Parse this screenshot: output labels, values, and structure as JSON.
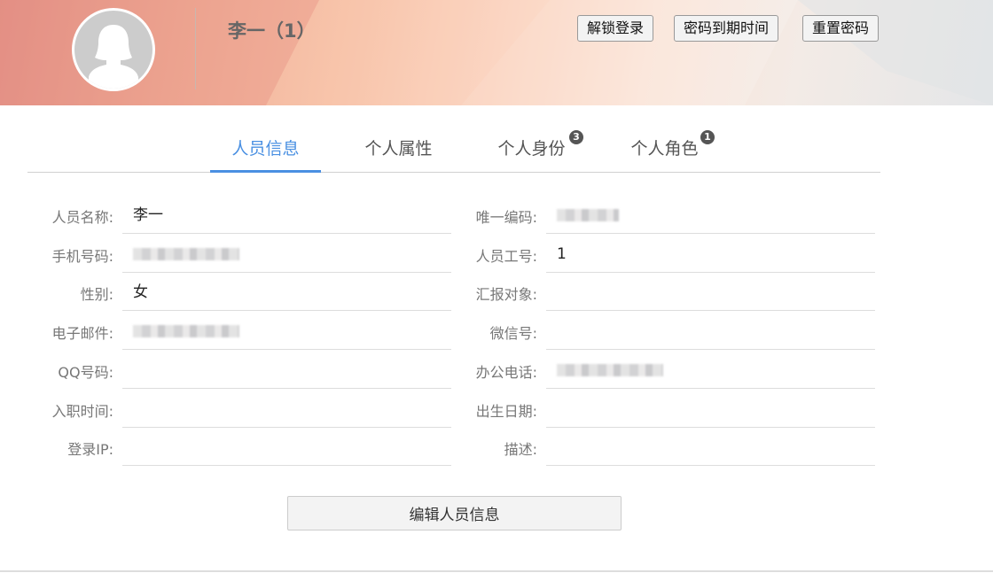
{
  "header": {
    "name": "李一（1）",
    "buttons": [
      "解锁登录",
      "密码到期时间",
      "重置密码"
    ]
  },
  "tabs": [
    {
      "label": "人员信息",
      "badge": null
    },
    {
      "label": "个人属性",
      "badge": null
    },
    {
      "label": "个人身份",
      "badge": "3"
    },
    {
      "label": "个人角色",
      "badge": "1"
    }
  ],
  "left_fields": [
    {
      "label": "人员名称:",
      "value": "李一"
    },
    {
      "label": "手机号码:",
      "value": ""
    },
    {
      "label": "性别:",
      "value": "女"
    },
    {
      "label": "电子邮件:",
      "value": ""
    },
    {
      "label": "QQ号码:",
      "value": ""
    },
    {
      "label": "入职时间:",
      "value": ""
    },
    {
      "label": "登录IP:",
      "value": ""
    }
  ],
  "right_fields": [
    {
      "label": "唯一编码:",
      "value": ""
    },
    {
      "label": "人员工号:",
      "value": "1"
    },
    {
      "label": "汇报对象:",
      "value": ""
    },
    {
      "label": "微信号:",
      "value": ""
    },
    {
      "label": "办公电话:",
      "value": ""
    },
    {
      "label": "出生日期:",
      "value": ""
    },
    {
      "label": "描述:",
      "value": ""
    }
  ],
  "edit_button": "编辑人员信息",
  "colors": {
    "accent": "#4a90e2",
    "badge": "#555555"
  }
}
